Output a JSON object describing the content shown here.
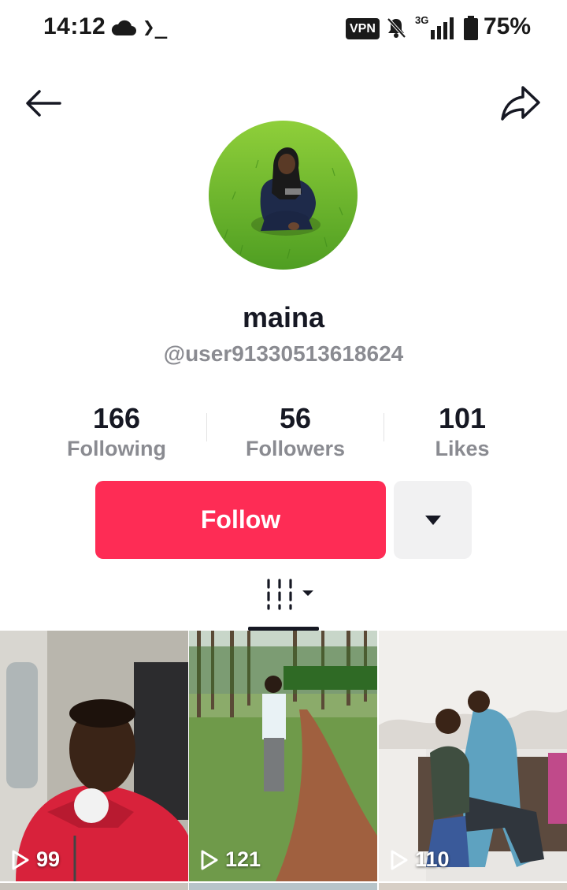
{
  "status_bar": {
    "time": "14:12",
    "terminal_glyph": "❯_",
    "vpn": "VPN",
    "network": "3G",
    "battery": "75%"
  },
  "nav": {
    "back_icon": "arrow-left-icon",
    "share_icon": "share-arrow-icon"
  },
  "profile": {
    "display_name": "maina",
    "username": "@user91330513618624"
  },
  "stats": [
    {
      "value": "166",
      "label": "Following"
    },
    {
      "value": "56",
      "label": "Followers"
    },
    {
      "value": "101",
      "label": "Likes"
    }
  ],
  "actions": {
    "follow_label": "Follow",
    "more_icon": "caret-down-icon"
  },
  "tabs": {
    "videos_icon": "grid-columns-icon"
  },
  "videos": [
    {
      "views": "99"
    },
    {
      "views": "121"
    },
    {
      "views": "110"
    }
  ],
  "colors": {
    "accent": "#fe2c55",
    "secondary_text": "#8a8b91",
    "primary_text": "#161823"
  }
}
